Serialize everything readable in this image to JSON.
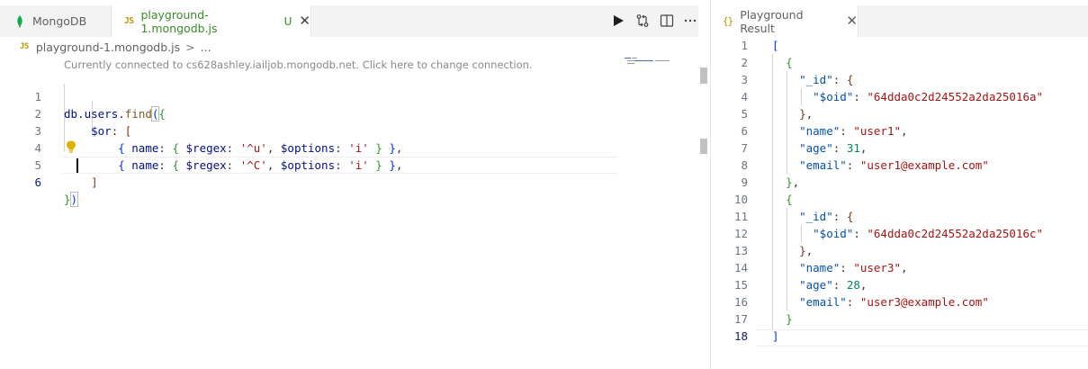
{
  "editor": {
    "tabs": [
      {
        "label": "MongoDB",
        "icon": "mongodb-leaf-icon"
      },
      {
        "label": "playground-1.mongodb.js",
        "badge": "JS",
        "modified_marker": "U",
        "icon": "js-file-icon"
      }
    ],
    "actions": [
      "run-icon",
      "compare-changes-icon",
      "split-editor-icon",
      "more-actions-icon"
    ],
    "breadcrumb": {
      "badge": "JS",
      "file": "playground-1.mongodb.js",
      "separator": ">",
      "more": "..."
    },
    "codelens": "Currently connected to cs628ashley.iailjob.mongodb.net. Click here to change connection.",
    "line_numbers": [
      "1",
      "2",
      "3",
      "4",
      "5",
      "6"
    ],
    "lines": [
      "db.users.find({",
      "    $or: [",
      "        { name: { $regex: '^u', $options: 'i' } },",
      "        { name: { $regex: '^C', $options: 'i' } },",
      "    ]",
      "})"
    ],
    "active_line": "6"
  },
  "result": {
    "tab_label": "Playground Result",
    "tab_icon": "json-braces-icon",
    "line_numbers": [
      "1",
      "2",
      "3",
      "4",
      "5",
      "6",
      "7",
      "8",
      "9",
      "10",
      "11",
      "12",
      "13",
      "14",
      "15",
      "16",
      "17",
      "18"
    ],
    "lines": [
      "[",
      "  {",
      "    \"_id\": {",
      "      \"$oid\": \"64dda0c2d24552a2da25016a\"",
      "    },",
      "    \"name\": \"user1\",",
      "    \"age\": 31,",
      "    \"email\": \"user1@example.com\"",
      "  },",
      "  {",
      "    \"_id\": {",
      "      \"$oid\": \"64dda0c2d24552a2da25016c\"",
      "    },",
      "    \"name\": \"user3\",",
      "    \"age\": 28,",
      "    \"email\": \"user3@example.com\"",
      "  }",
      "]"
    ],
    "active_line": "18"
  },
  "colors": {
    "accent_green": "#3b8a2a",
    "js_badge": "#b89500",
    "json_key": "#0451a5",
    "json_string": "#a31515",
    "json_number": "#098658"
  }
}
